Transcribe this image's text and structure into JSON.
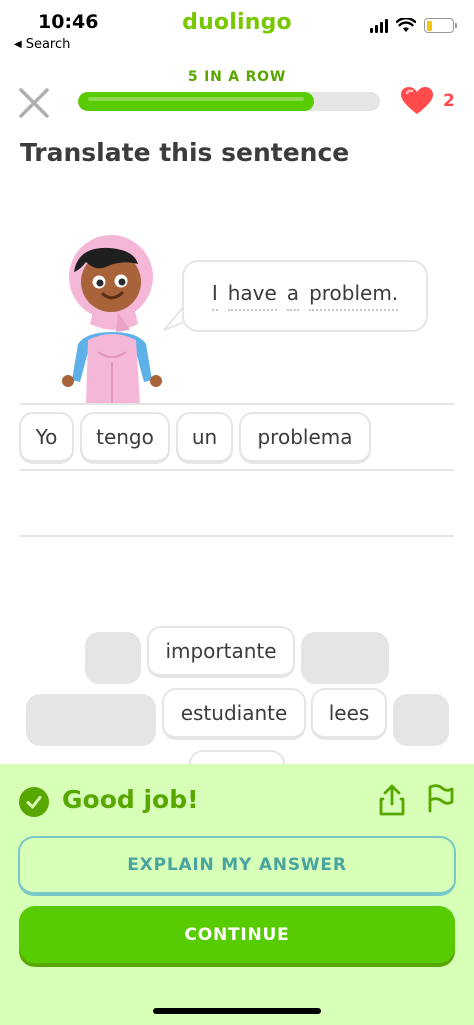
{
  "status_bar": {
    "time": "10:46",
    "back_label": "Search",
    "brand": "duolingo",
    "battery_level": 0.2
  },
  "header": {
    "streak_label": "5 IN A ROW",
    "progress": 0.78,
    "hearts_count": "2",
    "close_icon": "close-icon",
    "heart_icon": "heart-icon"
  },
  "lesson": {
    "instruction": "Translate this sentence",
    "prompt_words": [
      "I",
      "have",
      "a",
      "problem."
    ]
  },
  "answer_tiles": [
    "Yo",
    "tengo",
    "un",
    "problema"
  ],
  "word_bank": {
    "row1": [
      "importante"
    ],
    "row2": [
      "estudiante",
      "lees"
    ]
  },
  "feedback": {
    "message": "Good job!",
    "explain_label": "EXPLAIN MY ANSWER",
    "continue_label": "CONTINUE",
    "share_icon": "share-icon",
    "flag_icon": "flag-icon"
  },
  "colors": {
    "brand_green": "#58cc02",
    "dark_green": "#58a700",
    "panel_bg": "#d7ffb8",
    "heart_red": "#ff4b4b",
    "teal": "#4aa5a0"
  }
}
